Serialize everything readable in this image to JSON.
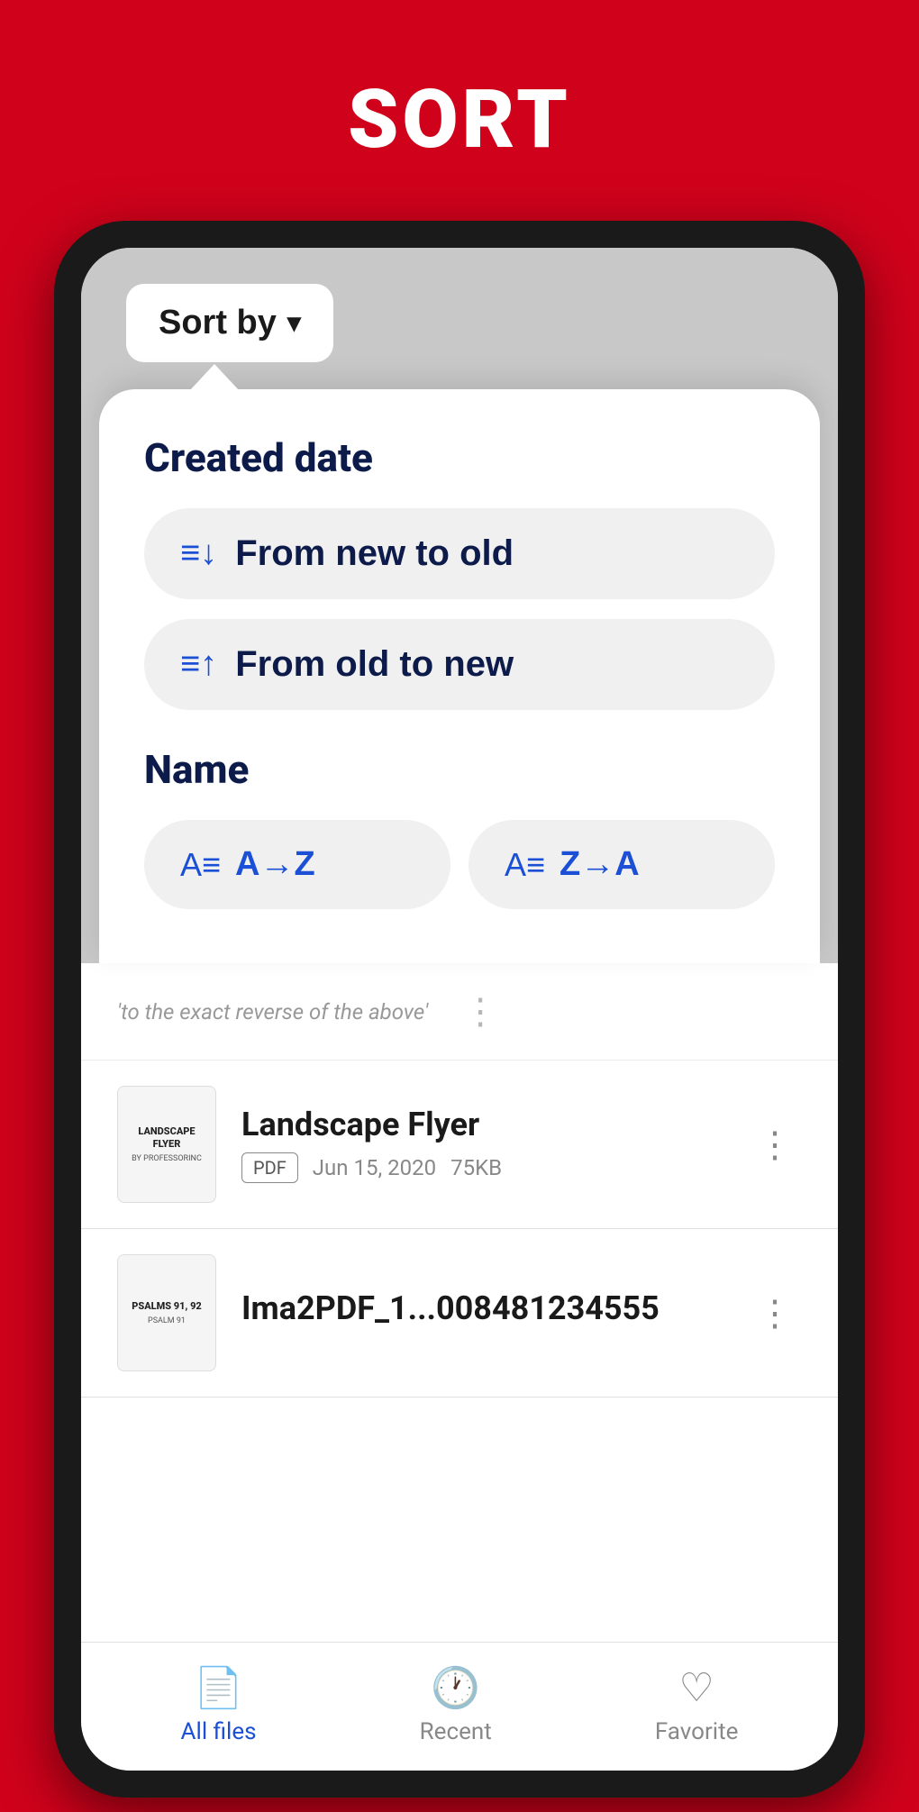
{
  "header": {
    "title": "SORT"
  },
  "sort_dropdown": {
    "label": "Sort by",
    "chevron": "▾"
  },
  "dropdown_panel": {
    "created_date_section": "Created date",
    "option_new_to_old": "From new to old",
    "option_old_to_new": "From old to new",
    "name_section": "Name",
    "option_a_to_z": "A→Z",
    "option_z_to_a": "Z→A",
    "icon_sort_down": "≡↓",
    "icon_sort_up": "≡↑",
    "icon_az": "A≡"
  },
  "files": [
    {
      "thumb_title": "LANDSCAPE FLYER",
      "thumb_subtitle": "BY PROFESSORINC",
      "name": "Landscape Flyer",
      "type": "PDF",
      "date": "Jun 15, 2020",
      "size": "75KB"
    },
    {
      "thumb_title": "PSALMS 91, 92",
      "thumb_subtitle": "PSALM 91",
      "name": "Ima2PDF_1...008481234555",
      "type": "",
      "date": "",
      "size": ""
    }
  ],
  "partial_text": "'to the exact reverse of the above'",
  "bottom_nav": {
    "all_files": "All files",
    "recent": "Recent",
    "favorite": "Favorite"
  }
}
